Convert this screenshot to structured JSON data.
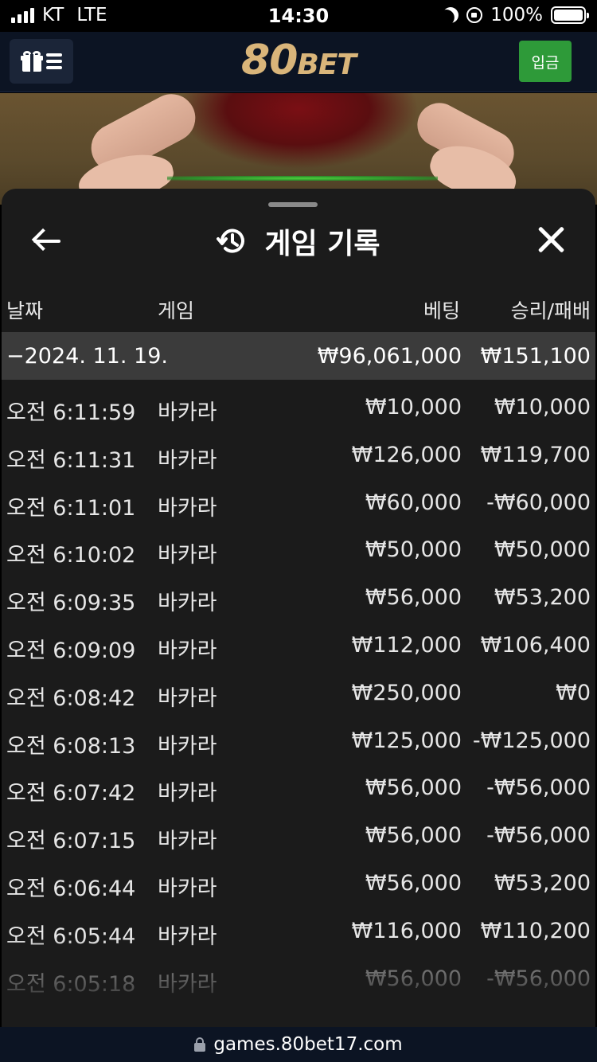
{
  "status_bar": {
    "carrier": "KT",
    "network": "LTE",
    "time": "14:30",
    "battery": "100%"
  },
  "header": {
    "logo_number": "80",
    "logo_text": "BET",
    "deposit_label": "입금"
  },
  "sheet": {
    "title": "게임 기록",
    "columns": {
      "date": "날짜",
      "game": "게임",
      "bet": "베팅",
      "result": "승리/패배"
    },
    "date_group": {
      "date": "−2024. 11. 19.",
      "bet_total": "₩96,061,000",
      "result_total": "₩151,100"
    },
    "rows": [
      {
        "time": "오전 6:11:59",
        "game": "바카라",
        "bet": "₩10,000",
        "result": "₩10,000"
      },
      {
        "time": "오전 6:11:31",
        "game": "바카라",
        "bet": "₩126,000",
        "result": "₩119,700"
      },
      {
        "time": "오전 6:11:01",
        "game": "바카라",
        "bet": "₩60,000",
        "result": "-₩60,000"
      },
      {
        "time": "오전 6:10:02",
        "game": "바카라",
        "bet": "₩50,000",
        "result": "₩50,000"
      },
      {
        "time": "오전 6:09:35",
        "game": "바카라",
        "bet": "₩56,000",
        "result": "₩53,200"
      },
      {
        "time": "오전 6:09:09",
        "game": "바카라",
        "bet": "₩112,000",
        "result": "₩106,400"
      },
      {
        "time": "오전 6:08:42",
        "game": "바카라",
        "bet": "₩250,000",
        "result": "₩0"
      },
      {
        "time": "오전 6:08:13",
        "game": "바카라",
        "bet": "₩125,000",
        "result": "-₩125,000"
      },
      {
        "time": "오전 6:07:42",
        "game": "바카라",
        "bet": "₩56,000",
        "result": "-₩56,000"
      },
      {
        "time": "오전 6:07:15",
        "game": "바카라",
        "bet": "₩56,000",
        "result": "-₩56,000"
      },
      {
        "time": "오전 6:06:44",
        "game": "바카라",
        "bet": "₩56,000",
        "result": "₩53,200"
      },
      {
        "time": "오전 6:05:44",
        "game": "바카라",
        "bet": "₩116,000",
        "result": "₩110,200"
      },
      {
        "time": "오전 6:05:18",
        "game": "바카라",
        "bet": "₩56,000",
        "result": "-₩56,000"
      }
    ]
  },
  "url_bar": {
    "url": "games.80bet17.com"
  },
  "colors": {
    "accent_green": "#2e9a39",
    "logo_gold": "#d9b57a",
    "sheet_bg": "#1b1b1b",
    "header_bg": "#0c1423"
  }
}
